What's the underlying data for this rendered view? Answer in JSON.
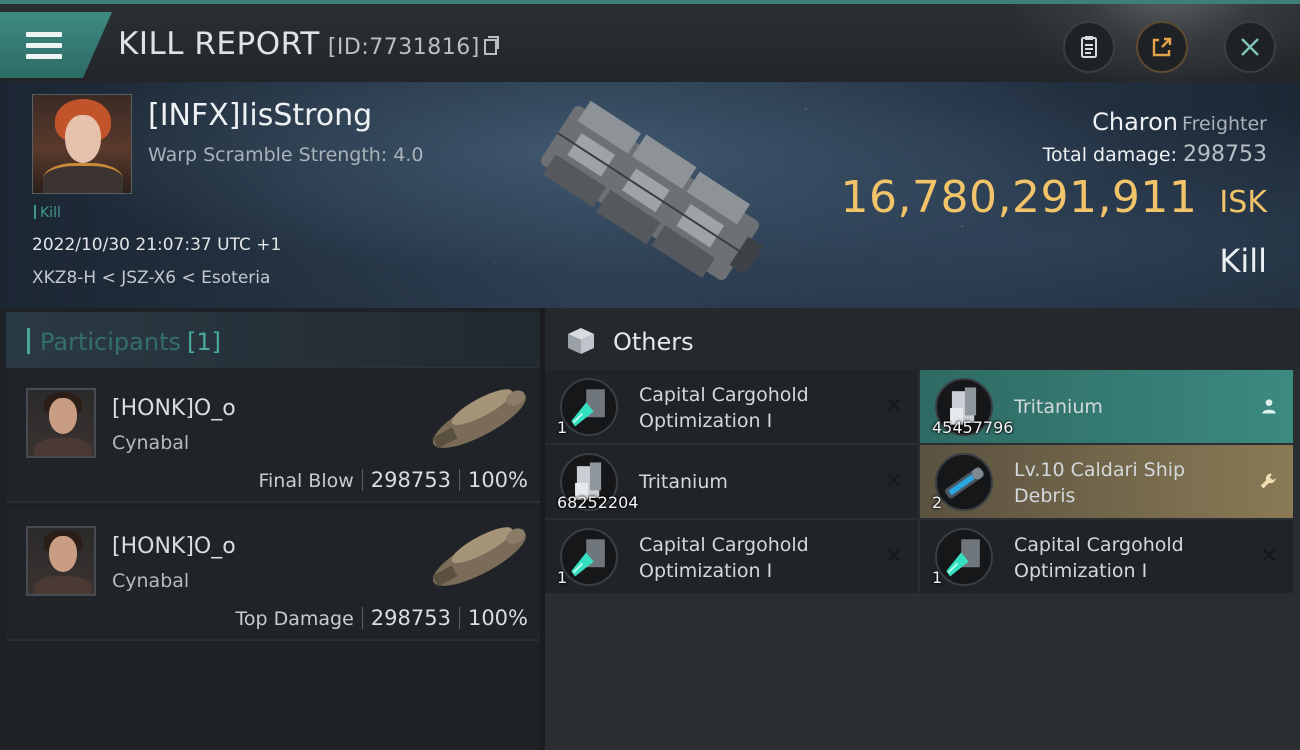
{
  "header": {
    "title": "KILL REPORT",
    "report_id": "[ID:7731816]"
  },
  "victim": {
    "name": "[INFX]IisStrong",
    "warp_scramble": "Warp Scramble Strength: 4.0",
    "kill_tag": "Kill",
    "datetime": "2022/10/30 21:07:37 UTC +1",
    "location": "XKZ8-H < JSZ-X6 < Esoteria",
    "ship_name": "Charon",
    "ship_class": "Freighter",
    "total_damage_label": "Total damage:",
    "total_damage": "298753",
    "isk_value": "16,780,291,911",
    "isk_unit": "ISK",
    "result": "Kill"
  },
  "participants": {
    "title": "Participants",
    "count": "[1]",
    "rows": [
      {
        "name": "[HONK]O_o",
        "ship": "Cynabal",
        "role": "Final Blow",
        "damage": "298753",
        "percent": "100%"
      },
      {
        "name": "[HONK]O_o",
        "ship": "Cynabal",
        "role": "Top Damage",
        "damage": "298753",
        "percent": "100%"
      }
    ]
  },
  "others": {
    "title": "Others",
    "items": [
      {
        "name": "Capital Cargohold Optimization I",
        "qty": "1",
        "icon": "rig-icon",
        "action": "close-icon"
      },
      {
        "name": "Tritanium",
        "qty": "45457796",
        "icon": "tritanium-icon",
        "action": "person-icon"
      },
      {
        "name": "Tritanium",
        "qty": "68252204",
        "icon": "tritanium-icon",
        "action": "close-icon"
      },
      {
        "name": "Lv.10 Caldari Ship Debris",
        "qty": "2",
        "icon": "debris-icon",
        "action": "wrench-icon"
      },
      {
        "name": "Capital Cargohold Optimization I",
        "qty": "1",
        "icon": "rig-icon",
        "action": "close-icon"
      },
      {
        "name": "Capital Cargohold Optimization I",
        "qty": "1",
        "icon": "rig-icon",
        "action": "close-icon"
      }
    ]
  },
  "colors": {
    "accent_teal": "#3e8a82",
    "isk_gold": "#f2c46a",
    "dropped_green": "#3b8a80",
    "special_gold": "#8a7a55"
  }
}
